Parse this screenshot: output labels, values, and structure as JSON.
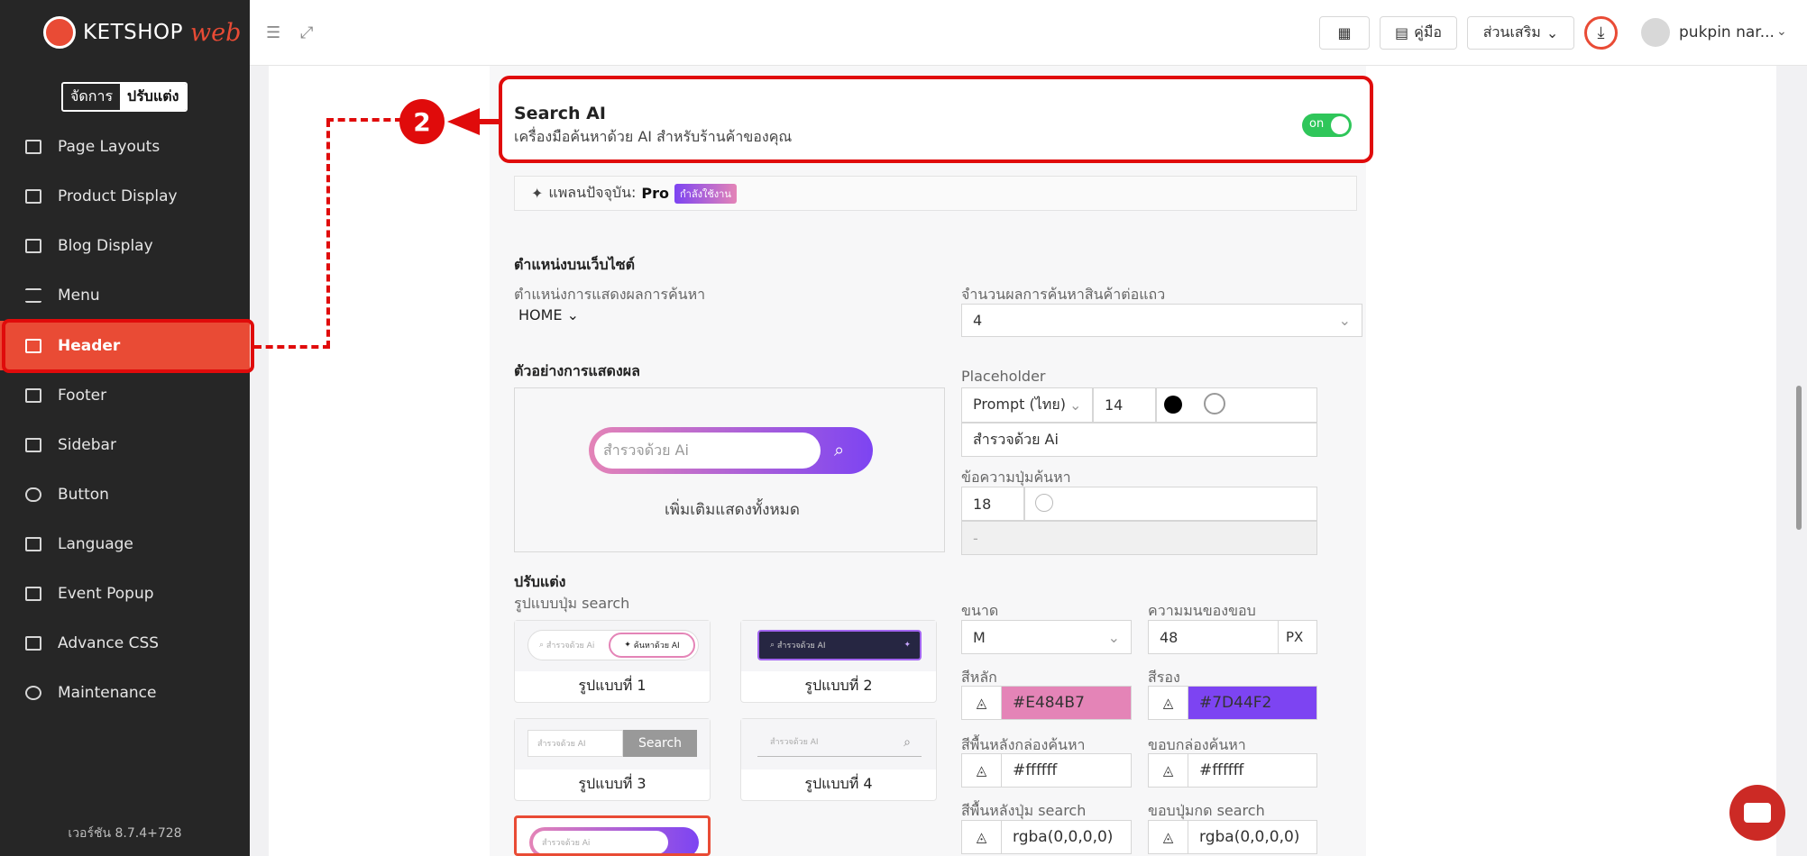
{
  "sidebar": {
    "logo_text": "KETSHOP",
    "logo_web": "web",
    "mode_manage": "จัดการ",
    "mode_customize": "ปรับแต่ง",
    "items": [
      {
        "label": "Page Layouts",
        "icon": "layout-icon"
      },
      {
        "label": "Product Display",
        "icon": "grid-icon"
      },
      {
        "label": "Blog Display",
        "icon": "blog-icon"
      },
      {
        "label": "Menu",
        "icon": "menu-icon"
      },
      {
        "label": "Header",
        "icon": "header-icon",
        "active": true
      },
      {
        "label": "Footer",
        "icon": "footer-icon"
      },
      {
        "label": "Sidebar",
        "icon": "sidebar-icon"
      },
      {
        "label": "Button",
        "icon": "toggle-icon"
      },
      {
        "label": "Language",
        "icon": "language-icon"
      },
      {
        "label": "Event Popup",
        "icon": "popup-icon"
      },
      {
        "label": "Advance CSS",
        "icon": "css-icon"
      },
      {
        "label": "Maintenance",
        "icon": "bug-icon"
      }
    ],
    "version": "เวอร์ชัน 8.7.4+728"
  },
  "topbar": {
    "guide_label": "คู่มือ",
    "addons_label": "ส่วนเสริม",
    "username": "pukpin nar..."
  },
  "search_ai": {
    "title": "Search AI",
    "subtitle": "เครื่องมือค้นหาด้วย AI สำหรับร้านค้าของคุณ",
    "toggle_label": "on",
    "plan_label": "แพลนปัจจุบัน:",
    "plan_name": "Pro",
    "plan_badge": "กำลังใช้งาน"
  },
  "position": {
    "section_title": "ตำแหน่งบนเว็บไซต์",
    "display_label": "ตำแหน่งการแสดงผลการค้นหา",
    "display_value": "HOME",
    "per_row_label": "จำนวนผลการค้นหาสินค้าต่อแถว",
    "per_row_value": "4"
  },
  "preview": {
    "section_title": "ตัวอย่างการแสดงผล",
    "search_placeholder": "สำรวจด้วย Ai",
    "more_label": "เพิ่มเติมแสดงทั้งหมด"
  },
  "placeholder_cfg": {
    "label": "Placeholder",
    "font": "Prompt (ไทย)",
    "size": "14",
    "text": "สำรวจด้วย Ai",
    "color": "#000000"
  },
  "button_text_cfg": {
    "label": "ข้อความปุ่มค้นหา",
    "size": "18",
    "text": "-"
  },
  "customize": {
    "section_title": "ปรับแต่ง",
    "style_label": "รูปแบบปุ่ม search",
    "styles": [
      {
        "caption": "รูปแบบที่ 1",
        "placeholder": "สำรวจด้วย Ai",
        "ai_button": "ค้นหาด้วย AI"
      },
      {
        "caption": "รูปแบบที่ 2",
        "placeholder": "สำรวจด้วย AI"
      },
      {
        "caption": "รูปแบบที่ 3",
        "placeholder": "สำรวจด้วย AI",
        "button": "Search"
      },
      {
        "caption": "รูปแบบที่ 4",
        "placeholder": "สำรวจด้วย AI"
      },
      {
        "placeholder": "สำรวจด้วย Ai"
      }
    ],
    "size_label": "ขนาด",
    "size_value": "M",
    "radius_label": "ความมนของขอบ",
    "radius_value": "48",
    "radius_unit": "PX",
    "primary_label": "สีหลัก",
    "primary_value": "#E484B7",
    "secondary_label": "สีรอง",
    "secondary_value": "#7D44F2",
    "box_bg_label": "สีพื้นหลังกล่องค้นหา",
    "box_bg_value": "#ffffff",
    "box_border_label": "ขอบกล่องค้นหา",
    "box_border_value": "#ffffff",
    "btn_bg_label": "สีพื้นหลังปุ่ม search",
    "btn_bg_value": "rgba(0,0,0,0)",
    "btn_border_label": "ขอบปุ่มกด search",
    "btn_border_value": "rgba(0,0,0,0)"
  },
  "annotation": {
    "step_number": "2"
  },
  "colors": {
    "accent": "#E94B35",
    "annotation": "#E00B0B",
    "toggle_on": "#2FC65A"
  }
}
